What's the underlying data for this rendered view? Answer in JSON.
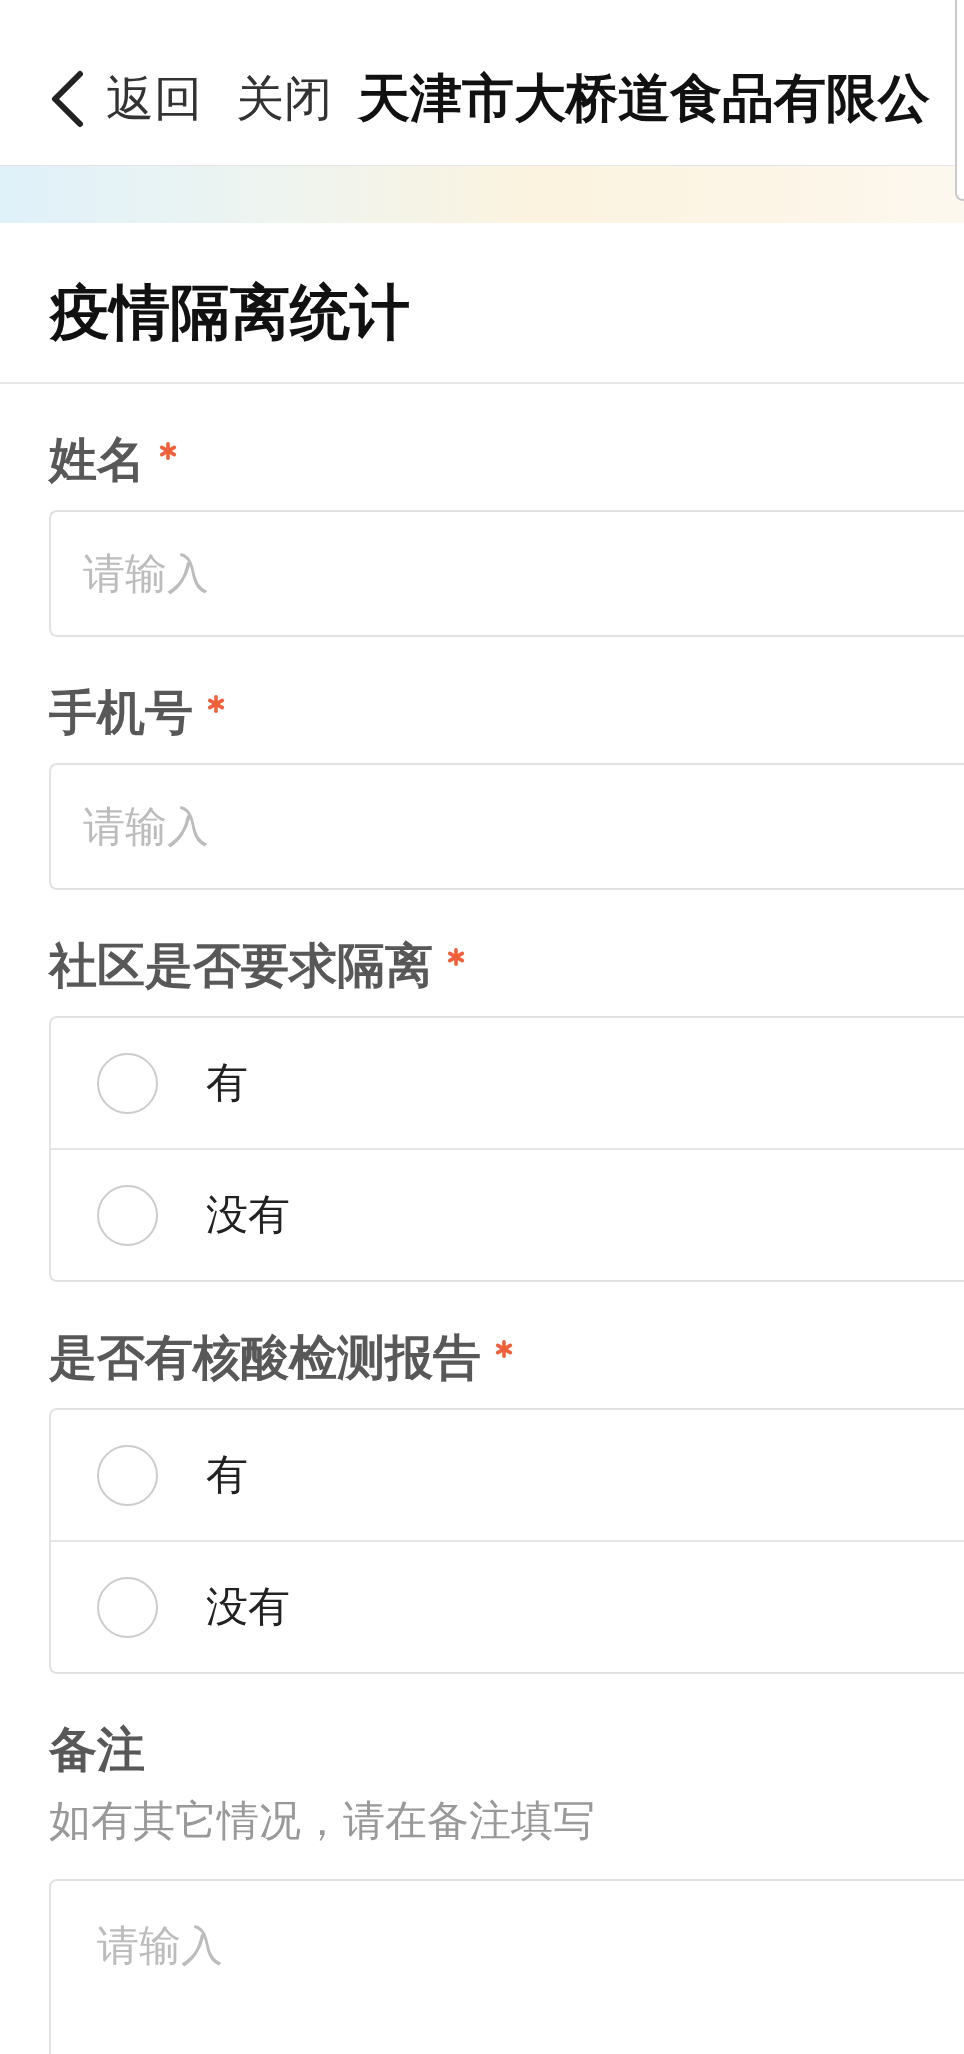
{
  "nav": {
    "back": "返回",
    "close": "关闭",
    "title": "天津市大桥道食品有限公"
  },
  "form": {
    "title": "疫情隔离统计",
    "fields": [
      {
        "kind": "text",
        "label": "姓名",
        "required": true,
        "placeholder": "请输入"
      },
      {
        "kind": "text",
        "label": "手机号",
        "required": true,
        "placeholder": "请输入"
      },
      {
        "kind": "radio",
        "label": "社区是否要求隔离",
        "required": true,
        "options": [
          {
            "label": "有",
            "selected": false
          },
          {
            "label": "没有",
            "selected": false
          }
        ]
      },
      {
        "kind": "radio",
        "label": "是否有核酸检测报告",
        "required": true,
        "options": [
          {
            "label": "有",
            "selected": false
          },
          {
            "label": "没有",
            "selected": false
          }
        ]
      },
      {
        "kind": "textarea",
        "label": "备注",
        "required": false,
        "hint": "如有其它情况，请在备注填写",
        "placeholder": "请输入"
      }
    ]
  }
}
